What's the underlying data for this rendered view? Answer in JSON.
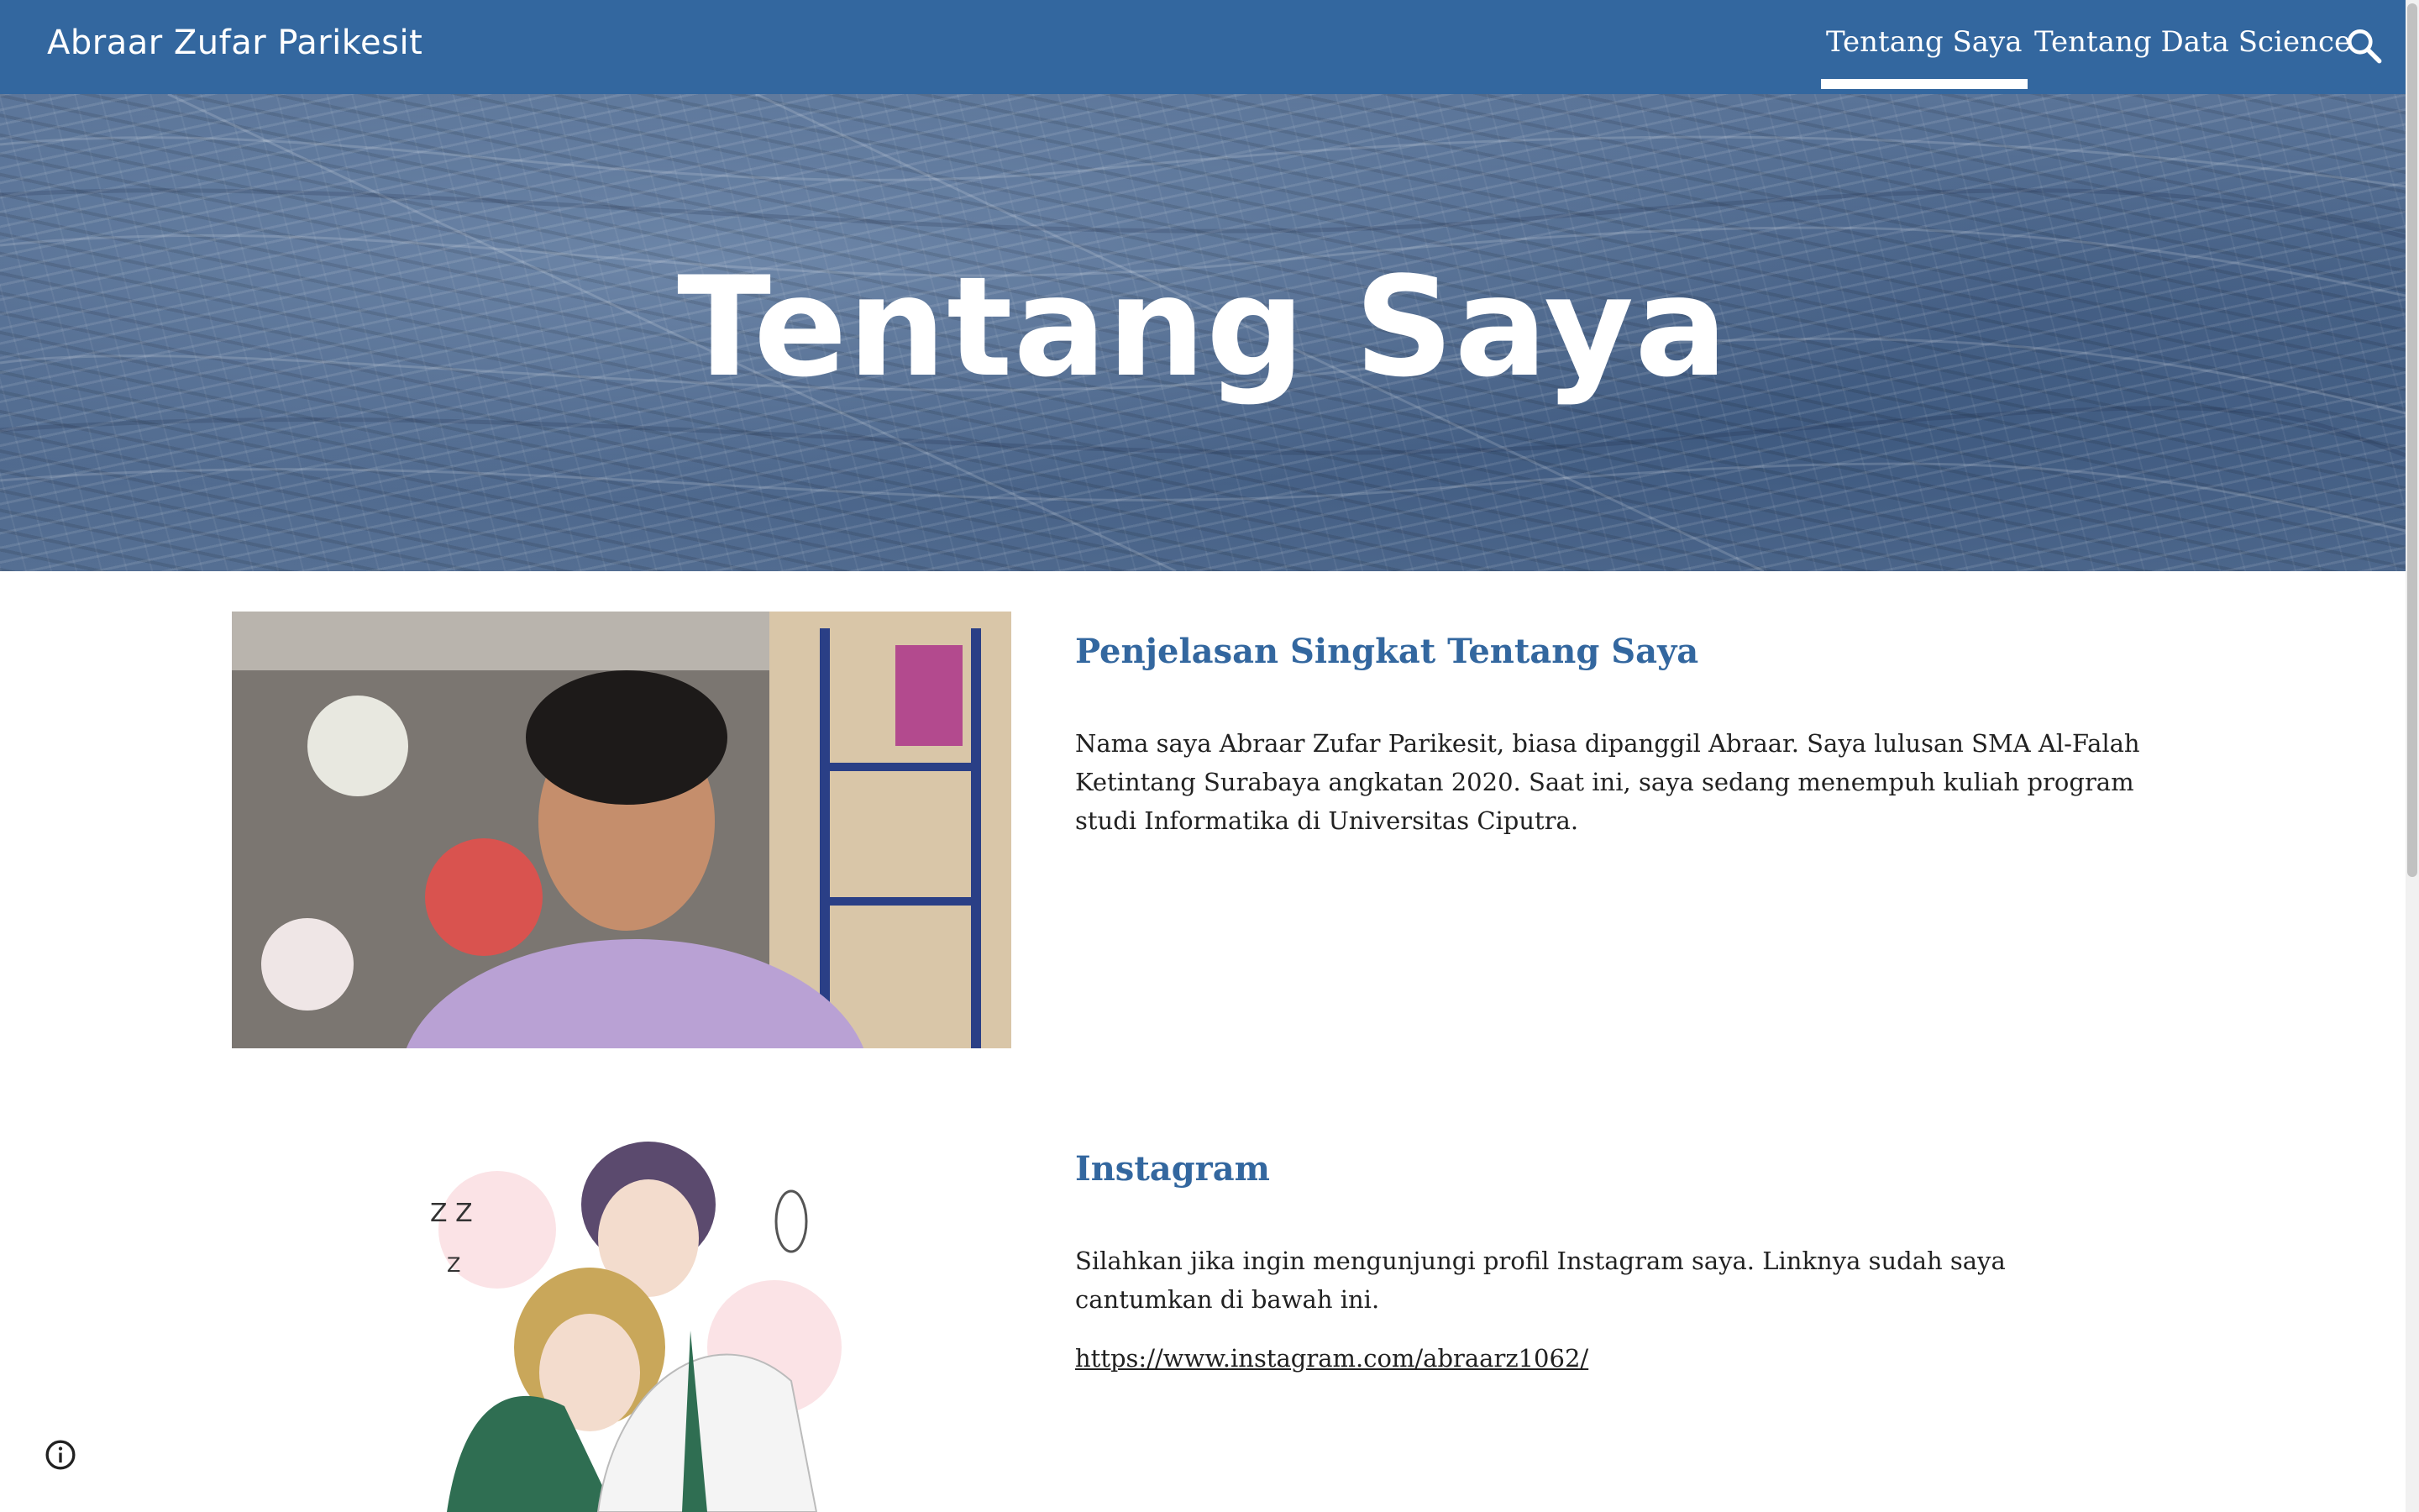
{
  "header": {
    "site_title": "Abraar Zufar Parikesit",
    "nav": [
      {
        "label": "Tentang Saya",
        "active": true
      },
      {
        "label": "Tentang Data Science",
        "active": false
      }
    ],
    "search_icon": "search-icon"
  },
  "hero": {
    "title": "Tentang Saya"
  },
  "sections": [
    {
      "heading": "Penjelasan Singkat Tentang Saya",
      "body": "Nama saya Abraar Zufar Parikesit, biasa dipanggil Abraar. Saya lulusan SMA Al-Falah Ketintang Surabaya angkatan 2020. Saat ini, saya sedang menempuh kuliah program studi Informatika di Universitas Ciputra."
    },
    {
      "heading": "Instagram",
      "body": "Silahkan jika ingin mengunjungi profil Instagram saya. Linknya sudah saya cantumkan di bawah ini.",
      "link": "https://www.instagram.com/abraarz1062/"
    }
  ],
  "footer": {
    "info_icon": "info-icon"
  },
  "colors": {
    "brand": "#33679f",
    "text": "#212121"
  }
}
